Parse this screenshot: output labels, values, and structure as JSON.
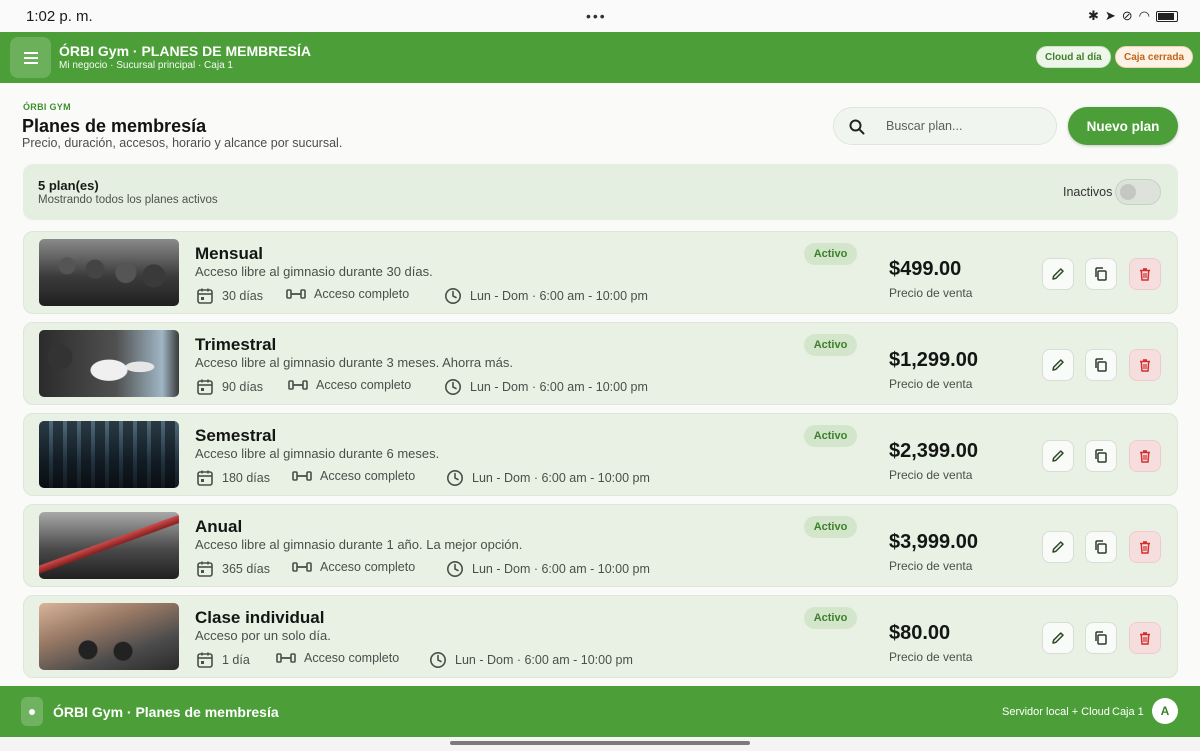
{
  "status_bar": {
    "time": "1:02 p. m.",
    "dots": "•••"
  },
  "app_bar": {
    "title": "ÓRBI Gym · PLANES DE MEMBRESÍA",
    "subtitle": "Mi negocio · Sucursal principal · Caja 1",
    "chip_cloud": "Cloud al día",
    "chip_caja": "Caja cerrada"
  },
  "header": {
    "brand": "ÓRBI GYM",
    "title": "Planes de membresía",
    "description": "Precio, duración, accesos, horario y alcance por sucursal.",
    "search_placeholder": "Buscar plan...",
    "new_plan_label": "Nuevo plan"
  },
  "summary": {
    "count": "5 plan(es)",
    "showing": "Mostrando todos los planes activos",
    "inactive_label": "Inactivos",
    "inactive_toggle": false
  },
  "plans": [
    {
      "name": "Mensual",
      "description": "Acceso libre al gimnasio durante 30 días.",
      "duration": "30 días",
      "access": "Acceso completo",
      "schedule": "Lun - Dom · 6:00 am - 10:00 pm",
      "status": "Activo",
      "price": "$499.00",
      "price_label": "Precio de venta"
    },
    {
      "name": "Trimestral",
      "description": "Acceso libre al gimnasio durante 3 meses. Ahorra más.",
      "duration": "90 días",
      "access": "Acceso completo",
      "schedule": "Lun - Dom · 6:00 am - 10:00 pm",
      "status": "Activo",
      "price": "$1,299.00",
      "price_label": "Precio de venta"
    },
    {
      "name": "Semestral",
      "description": "Acceso libre al gimnasio durante 6 meses.",
      "duration": "180 días",
      "access": "Acceso completo",
      "schedule": "Lun - Dom · 6:00 am - 10:00 pm",
      "status": "Activo",
      "price": "$2,399.00",
      "price_label": "Precio de venta"
    },
    {
      "name": "Anual",
      "description": "Acceso libre al gimnasio durante 1 año. La mejor opción.",
      "duration": "365 días",
      "access": "Acceso completo",
      "schedule": "Lun - Dom · 6:00 am - 10:00 pm",
      "status": "Activo",
      "price": "$3,999.00",
      "price_label": "Precio de venta"
    },
    {
      "name": "Clase individual",
      "description": "Acceso por un solo día.",
      "duration": "1 día",
      "access": "Acceso completo",
      "schedule": "Lun - Dom · 6:00 am - 10:00 pm",
      "status": "Activo",
      "price": "$80.00",
      "price_label": "Precio de venta"
    }
  ],
  "bottom_bar": {
    "title": "ÓRBI Gym · Planes de membresía",
    "server": "Servidor local + Cloud",
    "caja": "Caja 1",
    "avatar": "A"
  },
  "colors": {
    "brand_green": "#4c9f38",
    "danger_red": "#d32f2f",
    "warning_orange": "#c0651a"
  },
  "icons": [
    "menu-icon",
    "search-icon",
    "calendar-icon",
    "dumbbell-icon",
    "clock-icon",
    "pencil-icon",
    "copy-icon",
    "trash-icon"
  ]
}
